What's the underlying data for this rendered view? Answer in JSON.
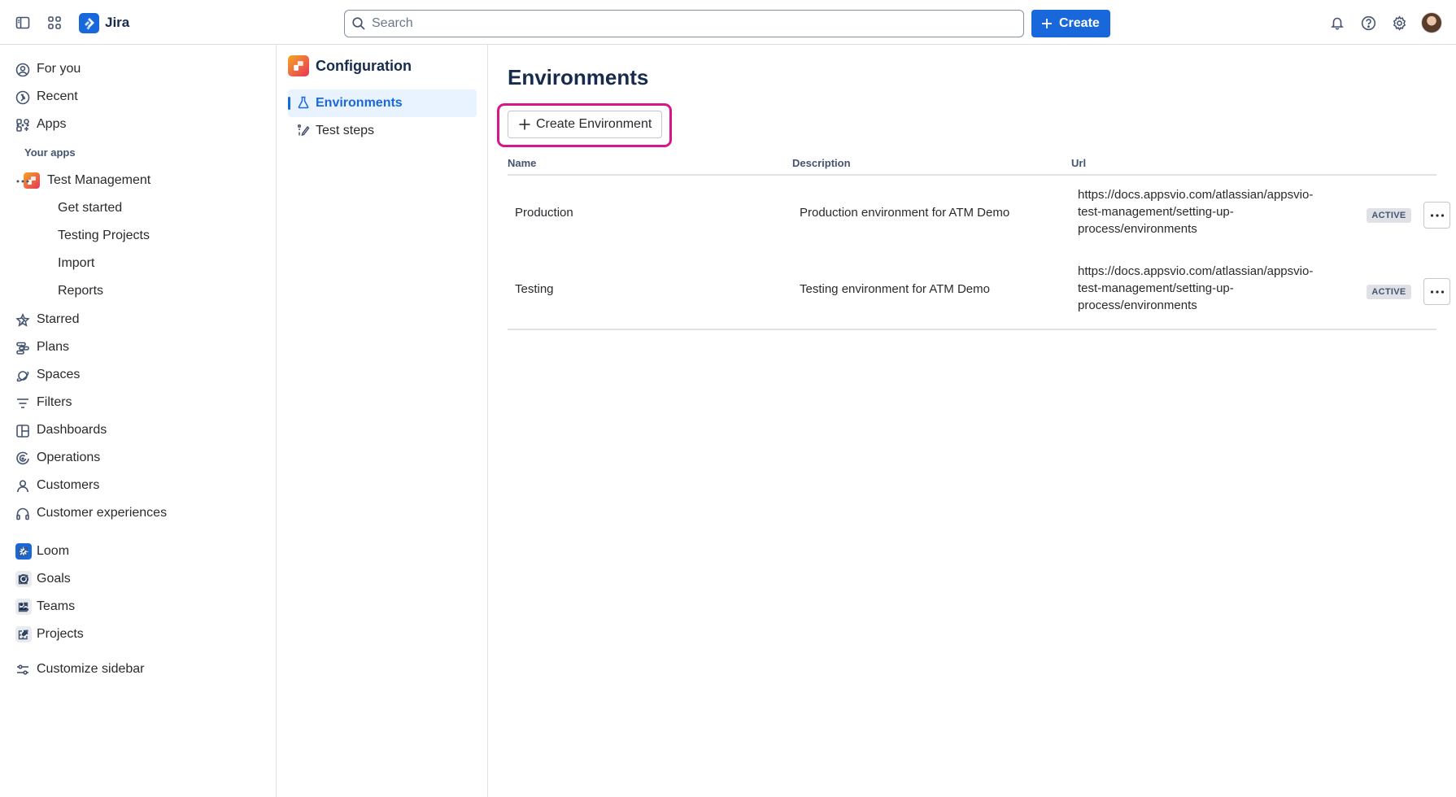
{
  "app": {
    "name": "Jira"
  },
  "topbar": {
    "search_placeholder": "Search",
    "create_label": "Create",
    "icons": [
      "sidebar-toggle-icon",
      "app-switcher-icon",
      "bell-icon",
      "help-icon",
      "gear-icon"
    ]
  },
  "sidebar": {
    "for_you": "For you",
    "recent": "Recent",
    "apps": "Apps",
    "your_apps": "Your apps",
    "test_management": "Test Management",
    "tm_children": [
      "Get started",
      "Testing Projects",
      "Import",
      "Reports"
    ],
    "starred": "Starred",
    "plans": "Plans",
    "spaces": "Spaces",
    "filters": "Filters",
    "dashboards": "Dashboards",
    "operations": "Operations",
    "customers": "Customers",
    "customer_experiences": "Customer experiences",
    "loom": "Loom",
    "goals": "Goals",
    "teams": "Teams",
    "projects": "Projects",
    "customize": "Customize sidebar"
  },
  "config": {
    "title": "Configuration",
    "items": [
      {
        "label": "Environments",
        "active": true
      },
      {
        "label": "Test steps",
        "active": false
      }
    ]
  },
  "main": {
    "title": "Environments",
    "create_button": "Create Environment",
    "columns": {
      "name": "Name",
      "description": "Description",
      "url": "Url"
    },
    "rows": [
      {
        "name": "Production",
        "description": "Production environment for ATM Demo",
        "url": [
          "https://docs.appsvio.com/atlassian/appsvio-",
          "test-management/setting-up-",
          "process/environments"
        ],
        "status": "ACTIVE"
      },
      {
        "name": "Testing",
        "description": "Testing environment for ATM Demo",
        "url": [
          "https://docs.appsvio.com/atlassian/appsvio-",
          "test-management/setting-up-",
          "process/environments"
        ],
        "status": "ACTIVE"
      }
    ]
  },
  "colors": {
    "brand": "#1868db",
    "highlight": "#d6178a",
    "active_bg": "#e9f2ff"
  }
}
